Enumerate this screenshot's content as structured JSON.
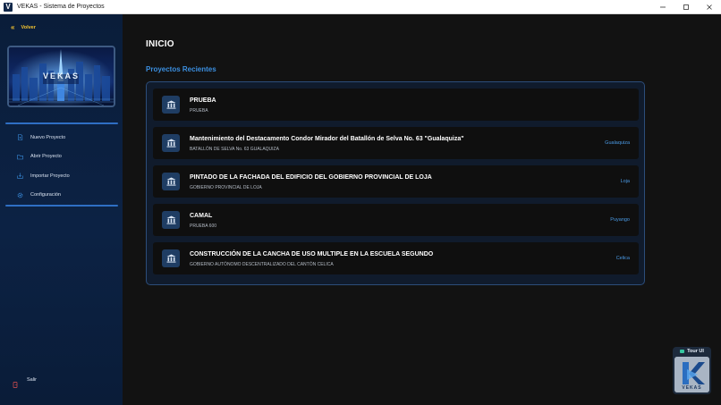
{
  "window": {
    "title": "VEKAS - Sistema de Proyectos",
    "app_icon_letter": "V"
  },
  "sidebar": {
    "back_label": "Volver",
    "logo_text": "VEKAS",
    "items": [
      {
        "label": "Nuevo Proyecto",
        "icon": "file-plus-icon"
      },
      {
        "label": "Abrir Proyecto",
        "icon": "folder-open-icon"
      },
      {
        "label": "Importar Proyecto",
        "icon": "import-icon"
      },
      {
        "label": "Configuración",
        "icon": "gear-icon"
      }
    ],
    "exit_label": "Salir"
  },
  "main": {
    "title": "INICIO",
    "section_title": "Proyectos Recientes",
    "projects": [
      {
        "name": "PRUEBA",
        "subtitle": "PRUEBA",
        "location": ""
      },
      {
        "name": "Mantenimiento del Destacamento Condor Mirador del Batallón de Selva No. 63 \"Gualaquiza\"",
        "subtitle": "BATALLÓN DE SELVA No. 63 GUALAQUIZA",
        "location": "Gualaquiza"
      },
      {
        "name": "PINTADO DE LA FACHADA DEL EDIFICIO DEL GOBIERNO PROVINCIAL DE LOJA",
        "subtitle": "GOBIERNO PROVINCIAL DE LOJA",
        "location": "Loja"
      },
      {
        "name": "CAMAL",
        "subtitle": "PRUEBA 600",
        "location": "Puyango"
      },
      {
        "name": "CONSTRUCCIÓN DE LA CANCHA DE USO MULTIPLE EN LA ESCUELA SEGUNDO",
        "subtitle": "GOBIERNO AUTÓNOMO DESCENTRALIZADO DEL CANTÓN CELICA",
        "location": "Celica"
      }
    ]
  },
  "tour": {
    "label": "Tour UI",
    "logo_text": "VEKAS"
  },
  "colors": {
    "accent": "#3b8fe0",
    "back_link": "#f2c230",
    "sidebar_bg": "#0c2244",
    "main_bg": "#121212",
    "exit_icon": "#e05050"
  }
}
